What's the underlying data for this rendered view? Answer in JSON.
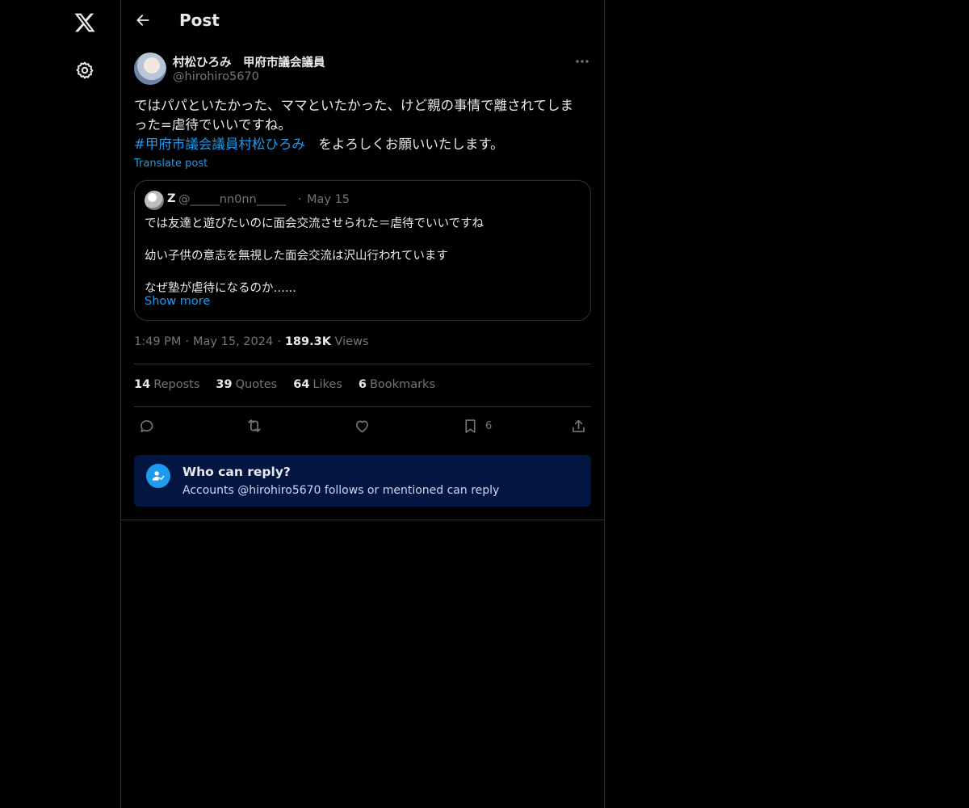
{
  "header": {
    "title": "Post"
  },
  "post": {
    "author": {
      "name": "村松ひろみ　甲府市議会議員",
      "handle": "@hirohiro5670"
    },
    "text_line1": "ではパパといたかった、ママといたかった、けど親の事情で離されてしま",
    "text_line2": "った=虐待でいいですね。",
    "hashtag": "#甲府市議会議員村松ひろみ",
    "text_after_hashtag": "　をよろしくお願いいたします。",
    "translate_label": "Translate post",
    "quote": {
      "name": "Z",
      "handle": "@_____nn0nn_____",
      "separator": "·",
      "date": "May 15",
      "lines": [
        "では友達と遊びたいのに面会交流させられた＝虐待でいいですね",
        "幼い子供の意志を無視した面会交流は沢山行われています",
        "なぜ塾が虐待になるのか…..."
      ],
      "show_more": "Show more"
    },
    "time": "1:49 PM",
    "date": "May 15, 2024",
    "views_count": "189.3K",
    "views_label": "Views",
    "meta_separator": "·",
    "stats": {
      "reposts_count": "14",
      "reposts_label": "Reposts",
      "quotes_count": "39",
      "quotes_label": "Quotes",
      "likes_count": "64",
      "likes_label": "Likes",
      "bookmarks_count": "6",
      "bookmarks_label": "Bookmarks"
    },
    "actions": {
      "reply_icon": "reply-icon",
      "repost_icon": "repost-icon",
      "like_icon": "like-icon",
      "bookmark_icon": "bookmark-icon",
      "bookmark_count": "6",
      "share_icon": "share-icon"
    },
    "reply_restriction": {
      "title": "Who can reply?",
      "subtitle": "Accounts @hirohiro5670 follows or mentioned can reply"
    }
  },
  "colors": {
    "background": "#000000",
    "text": "#e7e9ea",
    "secondary": "#71767b",
    "accent": "#1d9bf0",
    "border": "#2f3336",
    "reply_box": "#031541"
  }
}
